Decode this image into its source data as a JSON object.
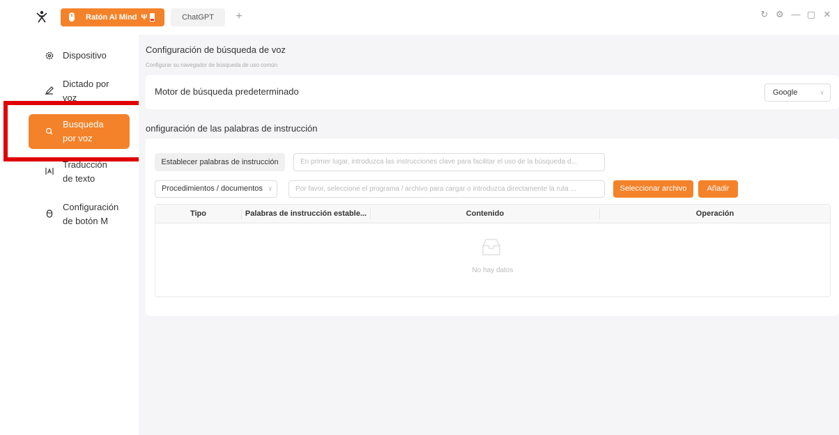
{
  "titlebar": {
    "active_tab": "Ratón AI Mind",
    "usb_icon": "usb-icon",
    "inactive_tab": "ChatGPT",
    "add_tab": "+",
    "controls": {
      "refresh": "↻",
      "settings": "⚙",
      "minimize": "—",
      "maximize": "▢",
      "close": "✕"
    }
  },
  "sidebar": {
    "items": [
      {
        "label": "Dispositivo",
        "icon": "gear-icon"
      },
      {
        "label": "Dictado por voz",
        "icon": "pen-icon"
      },
      {
        "label": "Busqueda por voz",
        "icon": "search-icon",
        "active": true
      },
      {
        "label": "Traducción de texto",
        "icon": "translate-icon"
      },
      {
        "label": "Configuración de botón M",
        "icon": "mouse-icon"
      }
    ]
  },
  "main": {
    "title": "Configuración de búsqueda de voz",
    "subtitle": "Configurar su navegador de búsqueda de uso común",
    "default_engine_label": "Motor de búsqueda predeterminado",
    "default_engine_value": "Google",
    "section_title": "onfiguración de las palabras de instrucción",
    "set_words_button": "Establecer palabras de instrucción",
    "keywords_placeholder": "En primer lugar, introduzca las instrucciones clave para facilitar el uso de la búsqueda d...",
    "type_select": "Procedimientos / documentos",
    "path_placeholder": "Por favor, seleccione el programa / archivo para cargar o introduzca directamente la ruta ...",
    "select_file_button": "Seleccionar archivo",
    "add_button": "Añadir",
    "table": {
      "columns": [
        "Tipo",
        "Palabras de instrucción estable...",
        "Contenido",
        "Operación"
      ],
      "rows": [],
      "empty_text": "No hay datos"
    }
  },
  "colors": {
    "accent": "#f4822a",
    "highlight": "#e00000",
    "background": "#f5f5f7"
  }
}
